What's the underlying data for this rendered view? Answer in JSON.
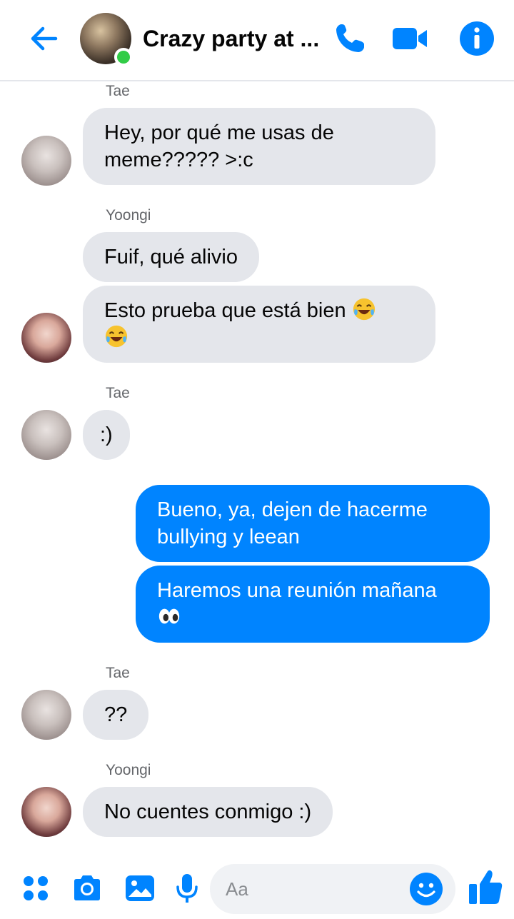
{
  "header": {
    "title": "Crazy party at ...",
    "icons": [
      "back-arrow-icon",
      "phone-icon",
      "video-camera-icon",
      "info-icon"
    ],
    "accent_color": "#0084ff",
    "online_color": "#31cc46"
  },
  "messages": [
    {
      "sender": "Tae",
      "direction": "incoming",
      "texts": [
        "Hey, por qué me usas de\nmeme????? >:c"
      ]
    },
    {
      "sender": "Yoongi",
      "direction": "incoming",
      "texts": [
        "Fuif, qué alivio",
        "Esto prueba que está bien"
      ]
    },
    {
      "sender": "Tae",
      "direction": "incoming",
      "texts": [
        ":)"
      ]
    },
    {
      "sender": "",
      "direction": "outgoing",
      "texts": [
        "Bueno, ya, dejen de hacerme\nbullying y leean",
        "Haremos una reunión mañana"
      ]
    },
    {
      "sender": "Tae",
      "direction": "incoming",
      "texts": [
        "??"
      ]
    },
    {
      "sender": "Yoongi",
      "direction": "incoming",
      "texts": [
        "No cuentes conmigo :)"
      ]
    }
  ],
  "emojis": [
    "tears-of-joy-emoji",
    "tears-of-joy-emoji",
    "eyes-emoji"
  ],
  "composer": {
    "placeholder": "Aa",
    "icons": [
      "apps-grid-icon",
      "camera-icon",
      "gallery-icon",
      "microphone-icon",
      "smiley-icon",
      "thumbs-up-icon"
    ]
  }
}
